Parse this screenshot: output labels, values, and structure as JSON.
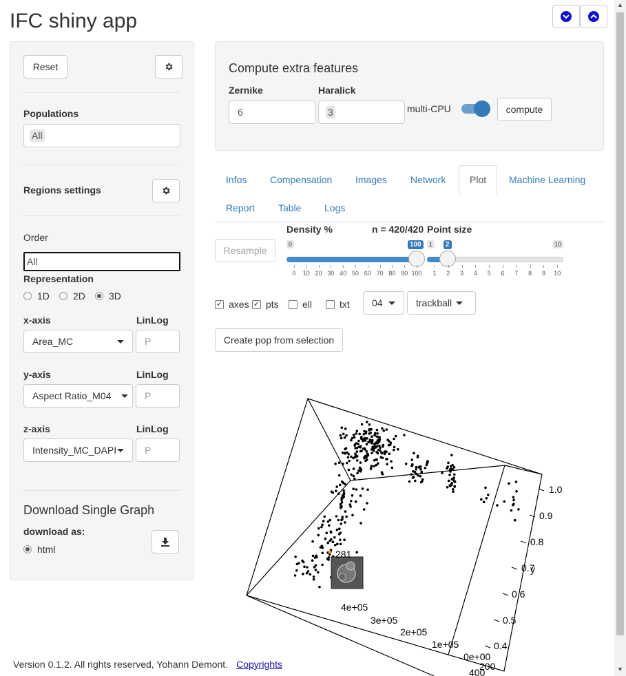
{
  "app": {
    "title": "IFC shiny app"
  },
  "sidebar": {
    "reset_label": "Reset",
    "populations_label": "Populations",
    "populations_value": "All",
    "regions_label": "Regions settings",
    "order_label": "Order",
    "order_value": "All",
    "representation_label": "Representation",
    "representation_options": [
      "1D",
      "2D",
      "3D"
    ],
    "representation_selected": "3D",
    "linlog_label": "LinLog",
    "linlog_placeholder": "P",
    "x_axis_label": "x-axis",
    "x_axis_value": "Area_MC",
    "y_axis_label": "y-axis",
    "y_axis_value": "Aspect Ratio_M04",
    "z_axis_label": "z-axis",
    "z_axis_value": "Intensity_MC_DAPI",
    "download_title": "Download Single Graph",
    "download_as_label": "download as:",
    "download_option": "html"
  },
  "compute": {
    "title": "Compute extra features",
    "zernike_label": "Zernike",
    "zernike_value": "6",
    "haralick_label": "Haralick",
    "haralick_value": "3",
    "multicpu_label": "multi-CPU",
    "multicpu_on": true,
    "compute_label": "compute"
  },
  "tabs": {
    "row1": [
      "Infos",
      "Compensation",
      "Images",
      "Network",
      "Plot",
      "Machine Learning"
    ],
    "row2": [
      "Report",
      "Table",
      "Logs"
    ],
    "active": "Plot"
  },
  "plot_controls": {
    "resample_label": "Resample",
    "density_label": "Density %",
    "n_label": "n = 420/420",
    "point_size_label": "Point size",
    "density_min": "0",
    "density_value": "100",
    "density_ticks": [
      "0",
      "10",
      "20",
      "30",
      "40",
      "50",
      "60",
      "70",
      "80",
      "90",
      "100"
    ],
    "point_min": "1",
    "point_value": "2",
    "point_max": "10",
    "point_ticks": [
      "1",
      "2",
      "3",
      "4",
      "5",
      "6",
      "7",
      "8",
      "9",
      "10"
    ],
    "check_axes": "axes",
    "check_pts": "pts",
    "check_ell": "ell",
    "check_txt": "txt",
    "select_04": "04",
    "select_trackball": "trackball",
    "create_pop_label": "Create pop from selection"
  },
  "plot3d": {
    "y_ticks": [
      "1.0",
      "0.9",
      "0.8",
      "0.7",
      "0.6",
      "0.5",
      "0.4"
    ],
    "y_axis_label": "y",
    "x_ticks": [
      "4e+05",
      "3e+05",
      "2e+05",
      "1e+05",
      "0e+00"
    ],
    "z_ticks": [
      "200",
      "400"
    ],
    "point_label": "281"
  },
  "footer": {
    "version_text": "Version 0.1.2. All rights reserved, Yohann Demont.",
    "copyrights_label": "Copyrights"
  }
}
